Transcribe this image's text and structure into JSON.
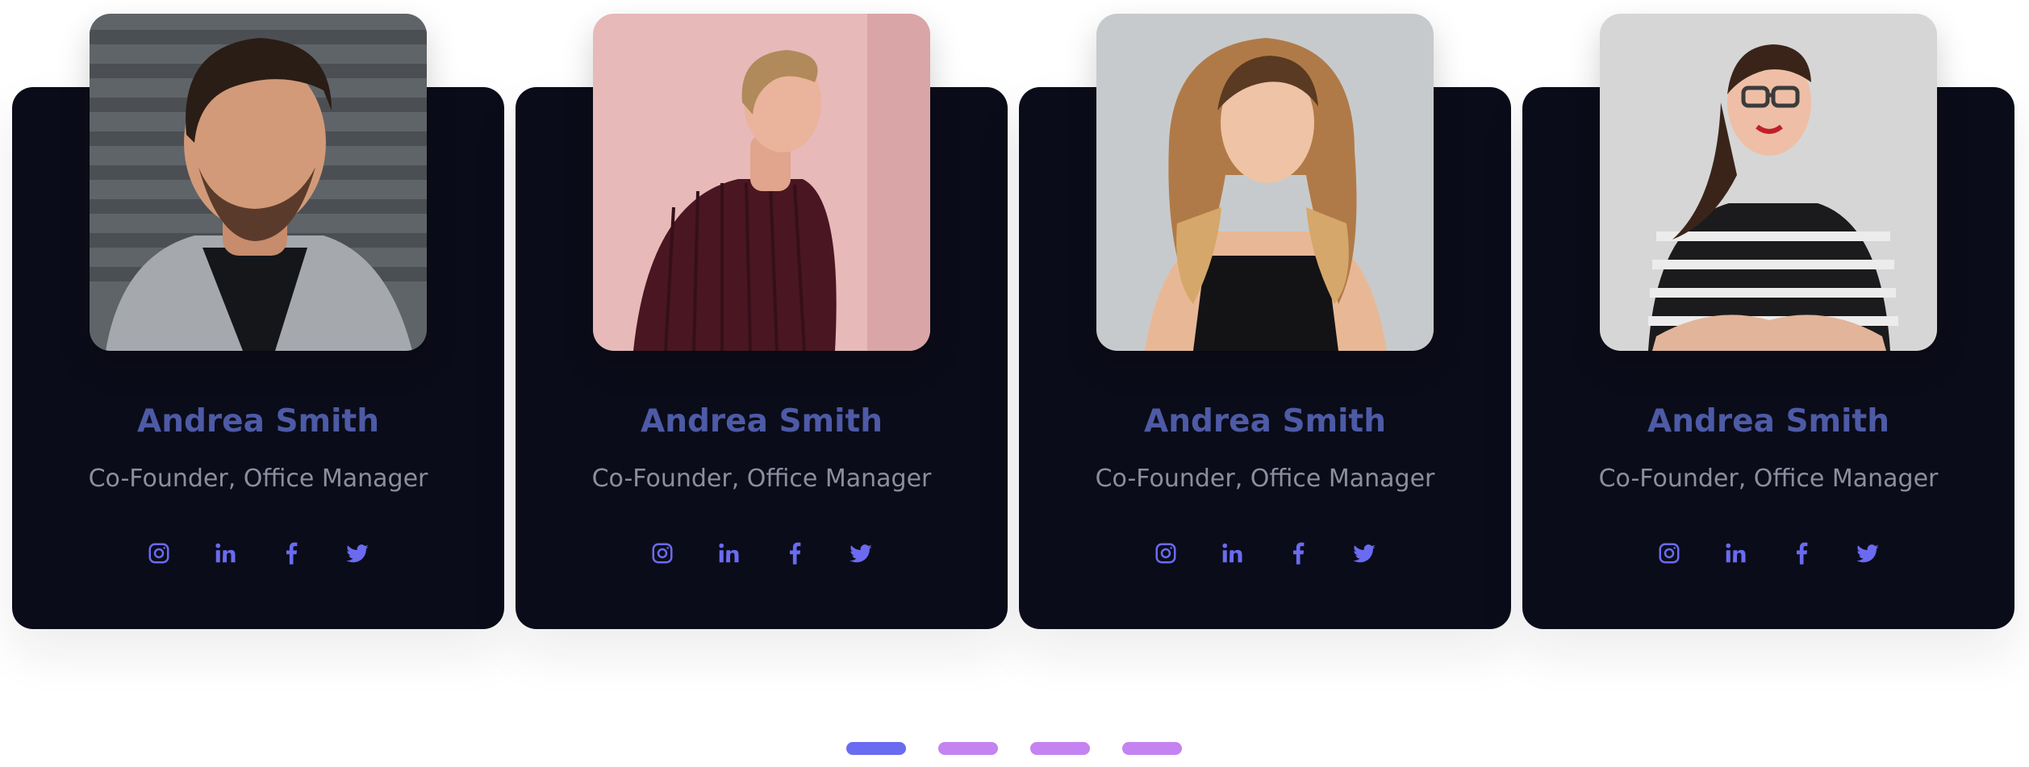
{
  "accent_color": "#6a6bf0",
  "name_color": "#4d5aa6",
  "card_color": "#0b0c19",
  "members": [
    {
      "name": "Andrea Smith",
      "role": "Co-Founder, Office Manager",
      "photo": "man-in-grey-hoodie-photo",
      "socials": [
        "instagram-icon",
        "linkedin-icon",
        "facebook-icon",
        "twitter-icon"
      ]
    },
    {
      "name": "Andrea Smith",
      "role": "Co-Founder, Office Manager",
      "photo": "man-in-maroon-sweater-photo",
      "socials": [
        "instagram-icon",
        "linkedin-icon",
        "facebook-icon",
        "twitter-icon"
      ]
    },
    {
      "name": "Andrea Smith",
      "role": "Co-Founder, Office Manager",
      "photo": "blonde-woman-photo",
      "socials": [
        "instagram-icon",
        "linkedin-icon",
        "facebook-icon",
        "twitter-icon"
      ]
    },
    {
      "name": "Andrea Smith",
      "role": "Co-Founder, Office Manager",
      "photo": "woman-with-glasses-photo",
      "socials": [
        "instagram-icon",
        "linkedin-icon",
        "facebook-icon",
        "twitter-icon"
      ]
    }
  ],
  "pagination": {
    "count": 4,
    "active": 1
  }
}
